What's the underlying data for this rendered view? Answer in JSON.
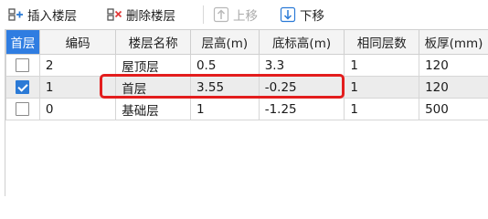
{
  "toolbar": {
    "insert_label": "插入楼层",
    "delete_label": "删除楼层",
    "move_up_label": "上移",
    "move_down_label": "下移"
  },
  "table": {
    "headers": [
      "首层",
      "编码",
      "楼层名称",
      "层高(m)",
      "底标高(m)",
      "相同层数",
      "板厚(mm)"
    ],
    "rows": [
      {
        "checked": false,
        "code": "2",
        "name": "屋顶层",
        "height": "0.5",
        "bottom": "3.3",
        "same": "1",
        "thick": "120"
      },
      {
        "checked": true,
        "code": "1",
        "name": "首层",
        "height": "3.55",
        "bottom": "-0.25",
        "same": "1",
        "thick": "120"
      },
      {
        "checked": false,
        "code": "0",
        "name": "基础层",
        "height": "1",
        "bottom": "-1.25",
        "same": "1",
        "thick": "500"
      }
    ]
  },
  "colors": {
    "header_selected": "#2f7de1",
    "checkbox_checked": "#2b7ad6",
    "highlight_box": "#e31d1d",
    "selected_row": "#ececec"
  }
}
